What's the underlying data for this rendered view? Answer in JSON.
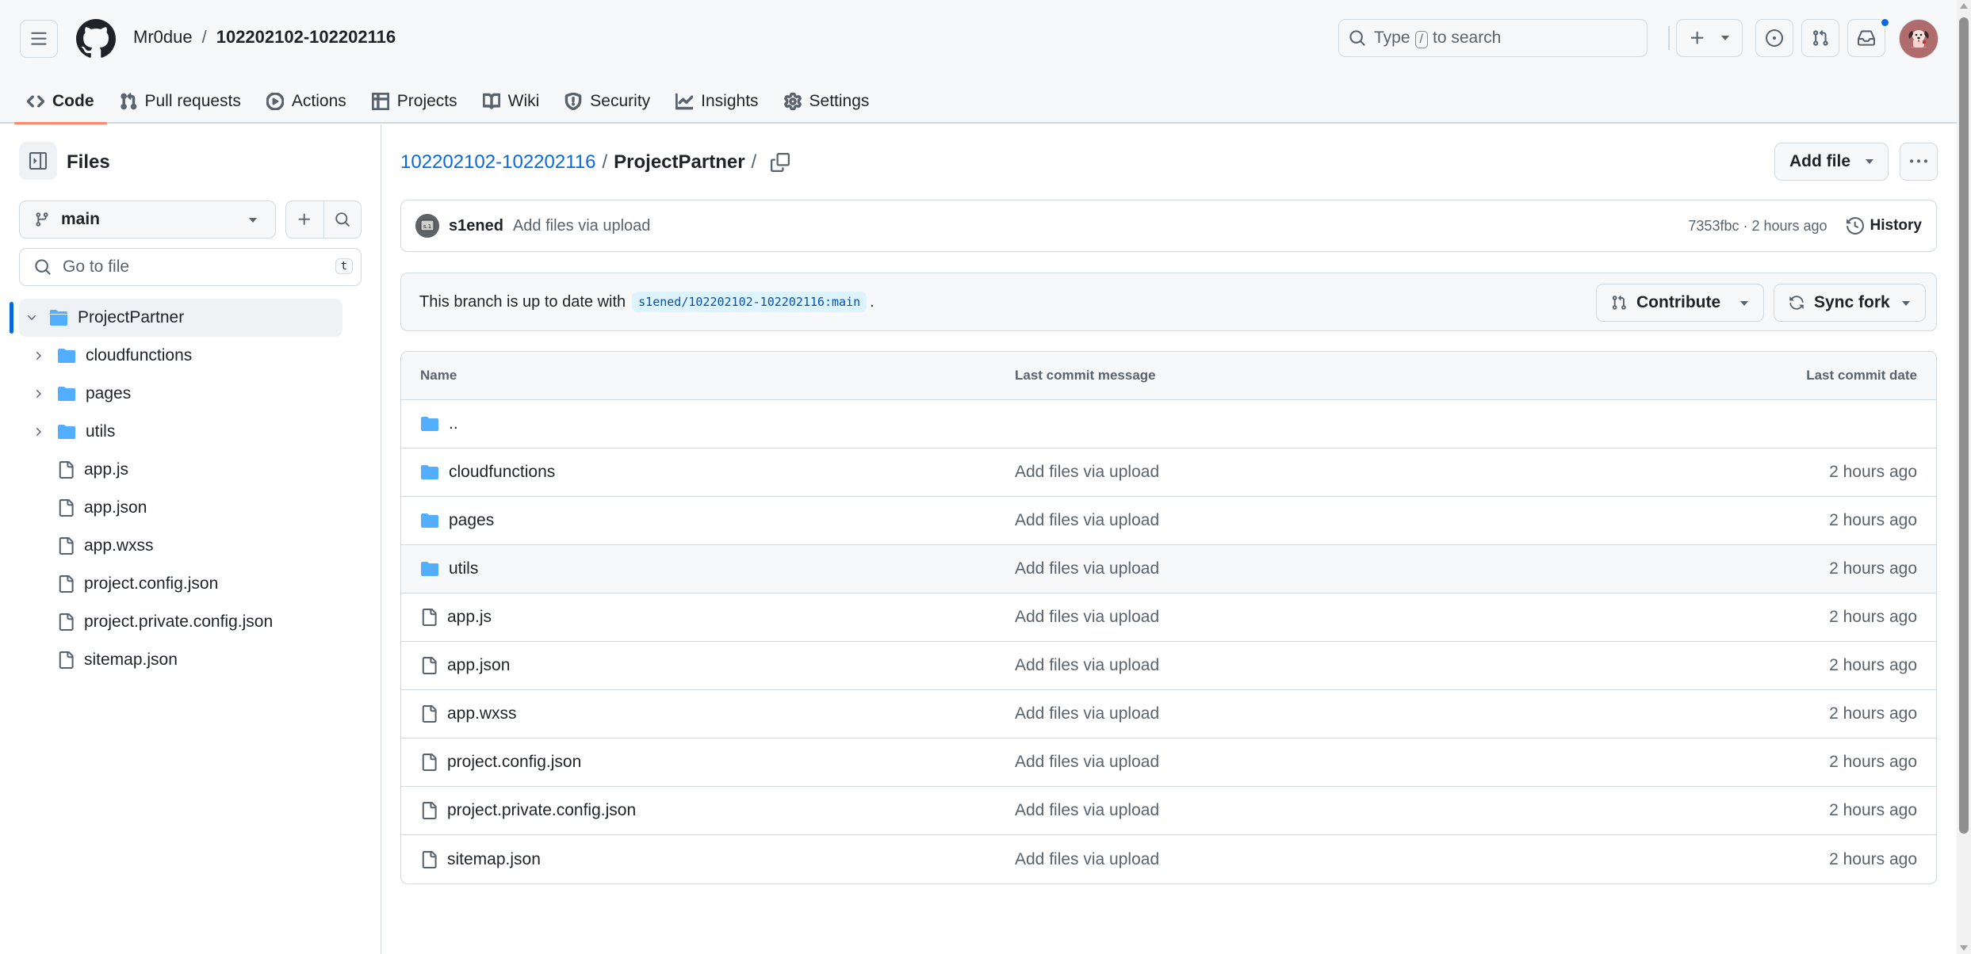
{
  "header": {
    "owner": "Mr0due",
    "separator": "/",
    "repo": "102202102-102202116",
    "search": {
      "prefix": "Type",
      "key": "/",
      "suffix": "to search"
    },
    "notification_dot_color": "#0969da"
  },
  "tabs": [
    {
      "label": "Code",
      "icon": "code-icon",
      "active": true
    },
    {
      "label": "Pull requests",
      "icon": "git-pull-request-icon"
    },
    {
      "label": "Actions",
      "icon": "play-icon"
    },
    {
      "label": "Projects",
      "icon": "table-icon"
    },
    {
      "label": "Wiki",
      "icon": "book-icon"
    },
    {
      "label": "Security",
      "icon": "shield-icon"
    },
    {
      "label": "Insights",
      "icon": "graph-icon"
    },
    {
      "label": "Settings",
      "icon": "gear-icon"
    }
  ],
  "sidebar": {
    "title": "Files",
    "branch": "main",
    "goto_placeholder": "Go to file",
    "goto_shortcut": "t",
    "tree": [
      {
        "label": "ProjectPartner",
        "type": "folder",
        "expanded": true,
        "level": 0
      },
      {
        "label": "cloudfunctions",
        "type": "folder",
        "expanded": false,
        "level": 1
      },
      {
        "label": "pages",
        "type": "folder",
        "expanded": false,
        "level": 1
      },
      {
        "label": "utils",
        "type": "folder",
        "expanded": false,
        "level": 1
      },
      {
        "label": "app.js",
        "type": "file",
        "level": 1
      },
      {
        "label": "app.json",
        "type": "file",
        "level": 1
      },
      {
        "label": "app.wxss",
        "type": "file",
        "level": 1
      },
      {
        "label": "project.config.json",
        "type": "file",
        "level": 1
      },
      {
        "label": "project.private.config.json",
        "type": "file",
        "level": 1
      },
      {
        "label": "sitemap.json",
        "type": "file",
        "level": 1
      }
    ]
  },
  "main": {
    "breadcrumb": {
      "repo": "102202102-102202116",
      "sep1": "/",
      "current": "ProjectPartner",
      "sep2": "/"
    },
    "add_file_label": "Add file",
    "commit": {
      "author": "s1ened",
      "message": "Add files via upload",
      "meta": "7353fbc · 2 hours ago",
      "history_label": "History"
    },
    "branch_status": {
      "text": "This branch is up to date with",
      "ref": "s1ened/102202102-102202116:main",
      "trailing": ".",
      "contribute_label": "Contribute",
      "sync_label": "Sync fork"
    },
    "table": {
      "headers": {
        "name": "Name",
        "message": "Last commit message",
        "date": "Last commit date"
      },
      "rows": [
        {
          "name": "..",
          "type": "folder",
          "message": "",
          "date": ""
        },
        {
          "name": "cloudfunctions",
          "type": "folder",
          "message": "Add files via upload",
          "date": "2 hours ago"
        },
        {
          "name": "pages",
          "type": "folder",
          "message": "Add files via upload",
          "date": "2 hours ago"
        },
        {
          "name": "utils",
          "type": "folder",
          "message": "Add files via upload",
          "date": "2 hours ago",
          "hover": true
        },
        {
          "name": "app.js",
          "type": "file",
          "message": "Add files via upload",
          "date": "2 hours ago"
        },
        {
          "name": "app.json",
          "type": "file",
          "message": "Add files via upload",
          "date": "2 hours ago"
        },
        {
          "name": "app.wxss",
          "type": "file",
          "message": "Add files via upload",
          "date": "2 hours ago"
        },
        {
          "name": "project.config.json",
          "type": "file",
          "message": "Add files via upload",
          "date": "2 hours ago"
        },
        {
          "name": "project.private.config.json",
          "type": "file",
          "message": "Add files via upload",
          "date": "2 hours ago"
        },
        {
          "name": "sitemap.json",
          "type": "file",
          "message": "Add files via upload",
          "date": "2 hours ago"
        }
      ]
    }
  },
  "colors": {
    "accent": "#0969da",
    "folder": "#54aeff",
    "tab_underline": "#fd8c73",
    "border": "#d1d9e0",
    "muted_text": "#59636e"
  }
}
